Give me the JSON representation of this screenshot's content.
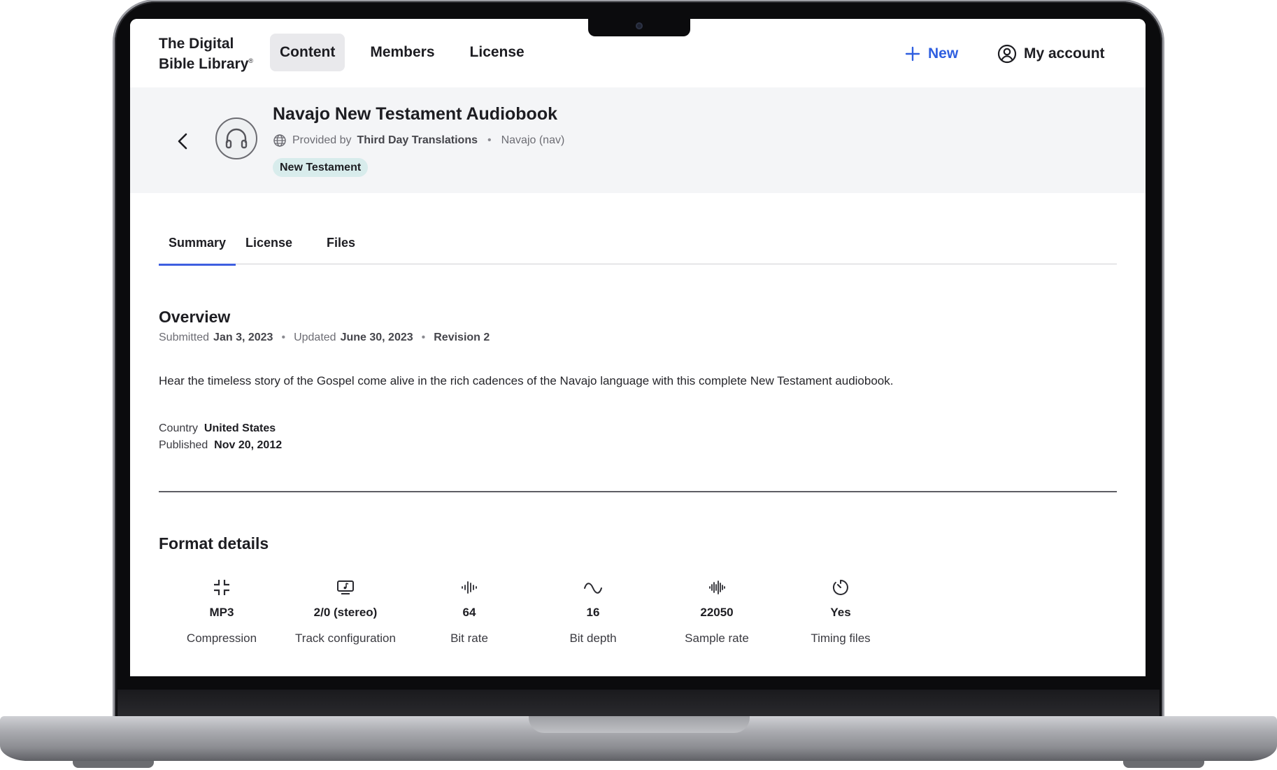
{
  "header": {
    "logo_line1": "The Digital",
    "logo_line2": "Bible Library",
    "logo_mark": "®",
    "nav": [
      {
        "label": "Content",
        "active": true
      },
      {
        "label": "Members",
        "active": false
      },
      {
        "label": "License",
        "active": false
      }
    ],
    "new_label": "New",
    "account_label": "My account"
  },
  "item": {
    "title": "Navajo New Testament Audiobook",
    "provided_by_prefix": "Provided by",
    "provider": "Third Day Translations",
    "language": "Navajo (nav)",
    "tag": "New Testament",
    "icon": "headphones-icon"
  },
  "tabs": [
    {
      "label": "Summary",
      "active": true
    },
    {
      "label": "License",
      "active": false
    },
    {
      "label": "Files",
      "active": false
    }
  ],
  "overview": {
    "heading": "Overview",
    "submitted_prefix": "Submitted",
    "submitted": "Jan 3, 2023",
    "updated_prefix": "Updated",
    "updated": "June 30, 2023",
    "revision": "Revision 2",
    "description": "Hear the timeless story of the Gospel come alive in the rich cadences of the Navajo language with this complete New Testament audiobook.",
    "country_label": "Country",
    "country": "United States",
    "published_label": "Published",
    "published": "Nov 20, 2012"
  },
  "format": {
    "heading": "Format details",
    "items": [
      {
        "value": "MP3",
        "label": "Compression",
        "icon": "compress-icon"
      },
      {
        "value": "2/0 (stereo)",
        "label": "Track configuration",
        "icon": "monitor-music-icon"
      },
      {
        "value": "64",
        "label": "Bit rate",
        "icon": "waveform-icon"
      },
      {
        "value": "16",
        "label": "Bit depth",
        "icon": "sine-wave-icon"
      },
      {
        "value": "22050",
        "label": "Sample rate",
        "icon": "audio-wave-icon"
      },
      {
        "value": "Yes",
        "label": "Timing files",
        "icon": "timer-icon"
      }
    ]
  },
  "colors": {
    "accent": "#2f5fe0",
    "tab_indicator": "#3e5fe0",
    "band_bg": "#f4f5f7",
    "tag_bg": "#d8ecec"
  }
}
